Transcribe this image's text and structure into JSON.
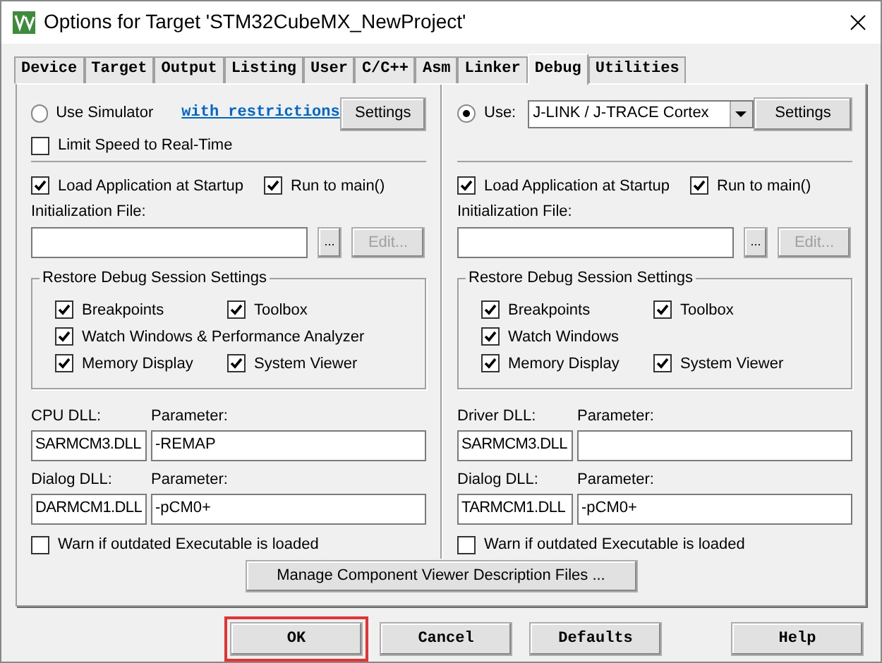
{
  "window": {
    "title": "Options for Target 'STM32CubeMX_NewProject'"
  },
  "tabs": [
    {
      "label": "Device",
      "selected": false
    },
    {
      "label": "Target",
      "selected": false
    },
    {
      "label": "Output",
      "selected": false
    },
    {
      "label": "Listing",
      "selected": false
    },
    {
      "label": "User",
      "selected": false
    },
    {
      "label": "C/C++",
      "selected": false
    },
    {
      "label": "Asm",
      "selected": false
    },
    {
      "label": "Linker",
      "selected": false
    },
    {
      "label": "Debug",
      "selected": true
    },
    {
      "label": "Utilities",
      "selected": false
    }
  ],
  "columns": [
    {
      "mode": {
        "label": "Use Simulator",
        "selected": false
      },
      "link": "with restrictions",
      "settings": "Settings",
      "speed_limit": {
        "label": "Limit Speed to Real-Time",
        "checked": false
      },
      "load": {
        "label": "Load Application at Startup",
        "checked": true
      },
      "run_to_main": {
        "label": "Run to main()",
        "checked": true
      },
      "init_label": "Initialization File:",
      "browse": "...",
      "edit": {
        "label": "Edit...",
        "disabled": true
      },
      "restore": {
        "title": "Restore Debug Session Settings",
        "rows": [
          [
            {
              "label": "Breakpoints",
              "checked": true
            },
            {
              "label": "Toolbox",
              "checked": true
            }
          ],
          [
            {
              "label": "Watch Windows & Performance Analyzer",
              "checked": true
            }
          ],
          [
            {
              "label": "Memory Display",
              "checked": true
            },
            {
              "label": "System Viewer",
              "checked": true
            }
          ]
        ]
      },
      "dlls": [
        {
          "label": "CPU DLL:",
          "param_label": "Parameter:",
          "dll": "SARMCM3.DLL",
          "param": "-REMAP"
        },
        {
          "label": "Dialog DLL:",
          "param_label": "Parameter:",
          "dll": "DARMCM1.DLL",
          "param": "-pCM0+"
        }
      ],
      "warn": {
        "label": "Warn if outdated Executable is loaded",
        "checked": false
      }
    },
    {
      "mode": {
        "label": "Use:",
        "selected": true
      },
      "dropdown": "J-LINK / J-TRACE Cortex",
      "settings": "Settings",
      "load": {
        "label": "Load Application at Startup",
        "checked": true
      },
      "run_to_main": {
        "label": "Run to main()",
        "checked": true
      },
      "init_label": "Initialization File:",
      "browse": "...",
      "edit": {
        "label": "Edit...",
        "disabled": true
      },
      "restore": {
        "title": "Restore Debug Session Settings",
        "rows": [
          [
            {
              "label": "Breakpoints",
              "checked": true
            },
            {
              "label": "Toolbox",
              "checked": true
            }
          ],
          [
            {
              "label": "Watch Windows",
              "checked": true
            }
          ],
          [
            {
              "label": "Memory Display",
              "checked": true
            },
            {
              "label": "System Viewer",
              "checked": true
            }
          ]
        ]
      },
      "dlls": [
        {
          "label": "Driver DLL:",
          "param_label": "Parameter:",
          "dll": "SARMCM3.DLL"
        },
        {
          "label": "Dialog DLL:",
          "param_label": "Parameter:",
          "dll": "TARMCM1.DLL",
          "param": "-pCM0+"
        }
      ],
      "warn": {
        "label": "Warn if outdated Executable is loaded",
        "checked": false
      }
    }
  ],
  "manage_button": "Manage Component Viewer Description Files ...",
  "buttons": [
    {
      "label": "OK",
      "highlighted": true
    },
    {
      "label": "Cancel",
      "highlighted": false
    },
    {
      "label": "Defaults",
      "highlighted": false
    },
    {
      "label": "Help",
      "highlighted": false
    }
  ]
}
